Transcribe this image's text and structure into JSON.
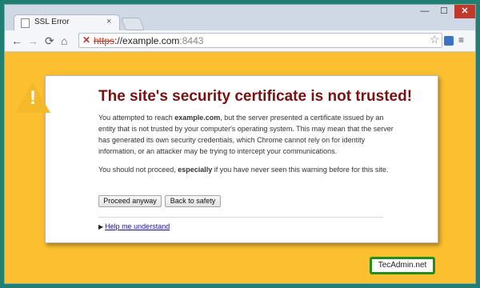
{
  "tab": {
    "title": "SSL Error",
    "close": "×"
  },
  "window_controls": {
    "minimize": "—",
    "maximize": "☐",
    "close": "✕"
  },
  "toolbar": {
    "back": "←",
    "forward": "→",
    "reload": "⟳",
    "home": "⌂",
    "url_scheme": "https",
    "url_rest": "://example.com",
    "url_port": ":8443",
    "star": "☆",
    "menu": "≡"
  },
  "error": {
    "heading": "The site's security certificate is not trusted!",
    "p1_before": "You attempted to reach ",
    "p1_domain": "example.com",
    "p1_after": ", but the server presented a certificate issued by an entity that is not trusted by your computer's operating system. This may mean that the server has generated its own security credentials, which Chrome cannot rely on for identity information, or an attacker may be trying to intercept your communications.",
    "p2_before": "You should not proceed, ",
    "p2_bold": "especially",
    "p2_after": " if you have never seen this warning before for this site.",
    "proceed_label": "Proceed anyway",
    "back_label": "Back to safety",
    "help_label": "Help me understand"
  },
  "watermark": "TecAdmin.net",
  "colors": {
    "background": "#fcbf30",
    "heading": "#7a1111",
    "badge_border": "#1f8f1f"
  }
}
